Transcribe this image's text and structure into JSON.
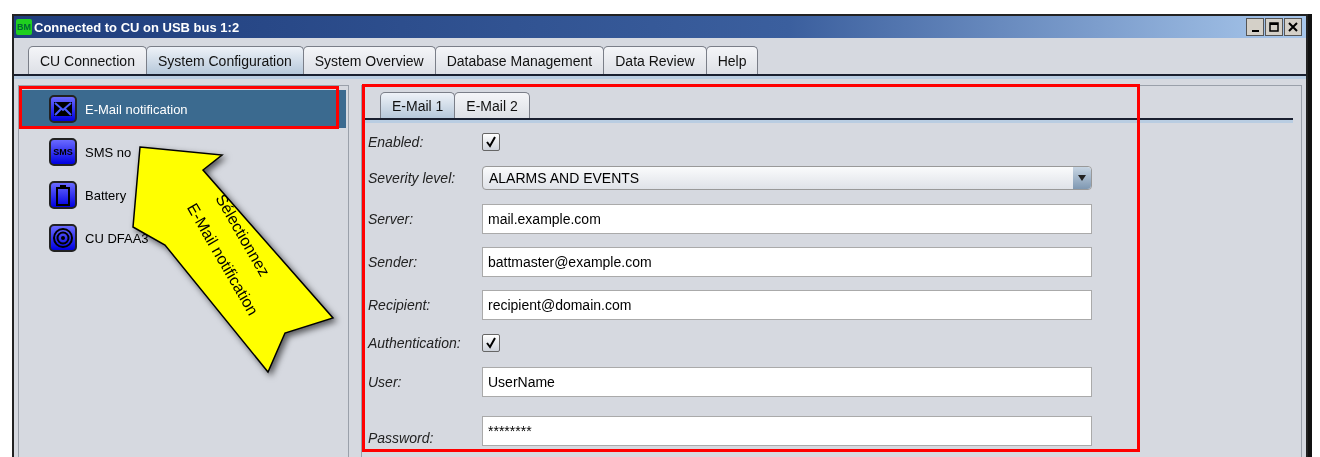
{
  "window": {
    "title": "Connected to CU on USB bus 1:2",
    "app_badge": "BM"
  },
  "tabs": [
    {
      "label": "CU Connection",
      "selected": false
    },
    {
      "label": "System Configuration",
      "selected": true
    },
    {
      "label": "System Overview",
      "selected": false
    },
    {
      "label": "Database Management",
      "selected": false
    },
    {
      "label": "Data Review",
      "selected": false
    },
    {
      "label": "Help",
      "selected": false
    }
  ],
  "sidebar": {
    "items": [
      {
        "label": "E-Mail notification",
        "selected": true
      },
      {
        "label": "SMS no",
        "icon_text": "SMS",
        "selected": false
      },
      {
        "label": "Battery",
        "selected": false
      },
      {
        "label": "CU DFAA3",
        "selected": false
      }
    ]
  },
  "subtabs": [
    {
      "label": "E-Mail 1",
      "selected": true
    },
    {
      "label": "E-Mail 2",
      "selected": false
    }
  ],
  "form": [
    {
      "kind": "checkbox",
      "label": "Enabled:",
      "checked": true
    },
    {
      "kind": "select",
      "label": "Severity level:",
      "value": "ALARMS AND EVENTS"
    },
    {
      "kind": "text",
      "label": "Server:",
      "value": "mail.example.com"
    },
    {
      "kind": "text",
      "label": "Sender:",
      "value": "battmaster@example.com"
    },
    {
      "kind": "text",
      "label": "Recipient:",
      "value": "recipient@domain.com"
    },
    {
      "kind": "checkbox",
      "label": "Authentication:",
      "checked": true
    },
    {
      "kind": "text",
      "label": "User:",
      "value": "UserName"
    },
    {
      "kind": "text",
      "label": "Password:",
      "value": "********"
    }
  ],
  "callout": {
    "lines": [
      "Sélectionnez",
      "E-Mail notification"
    ]
  }
}
